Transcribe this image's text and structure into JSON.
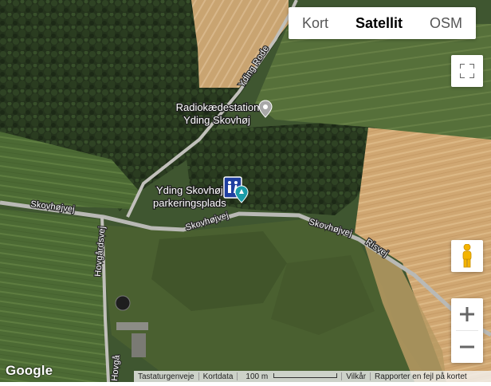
{
  "map_type": {
    "options": [
      "Kort",
      "Satellit",
      "OSM"
    ],
    "selected": "Satellit"
  },
  "roads": {
    "yding_rode": "Yding Rode",
    "skovhojvej_west": "Skovhøjvej",
    "skovhojvej_center": "Skovhøjvej",
    "skovhojvej_east": "Skovhøjvej",
    "risvej": "Risvej",
    "hovgardsvej": "Hovgårdsvej",
    "hovgardsvej_south": "Hovgå"
  },
  "places": {
    "radio_station": {
      "line1": "Radiokædestation",
      "line2": "Yding Skovhøj"
    },
    "parking": {
      "line1": "Yding Skovhøj",
      "line2": "parkeringsplads"
    }
  },
  "icons": {
    "fullscreen": "fullscreen-icon",
    "pegman": "pegman-icon",
    "zoom_in": "plus-icon",
    "zoom_out": "minus-icon",
    "poi_marker": "map-pin-icon",
    "toilet": "toilet-icon"
  },
  "attribution": {
    "logo": "Google",
    "keyboard_shortcuts": "Tastaturgenveje",
    "map_data": "Kortdata",
    "scale": "100 m",
    "terms": "Vilkår",
    "report": "Rapporter en fejl på kortet"
  },
  "colors": {
    "forest": "#2b3a22",
    "field_green": "#4f6a34",
    "field_wheat": "#d2ab78",
    "road": "#b9b9b5",
    "poi_teal": "#1a9ca8",
    "pegman": "#f4b400"
  }
}
